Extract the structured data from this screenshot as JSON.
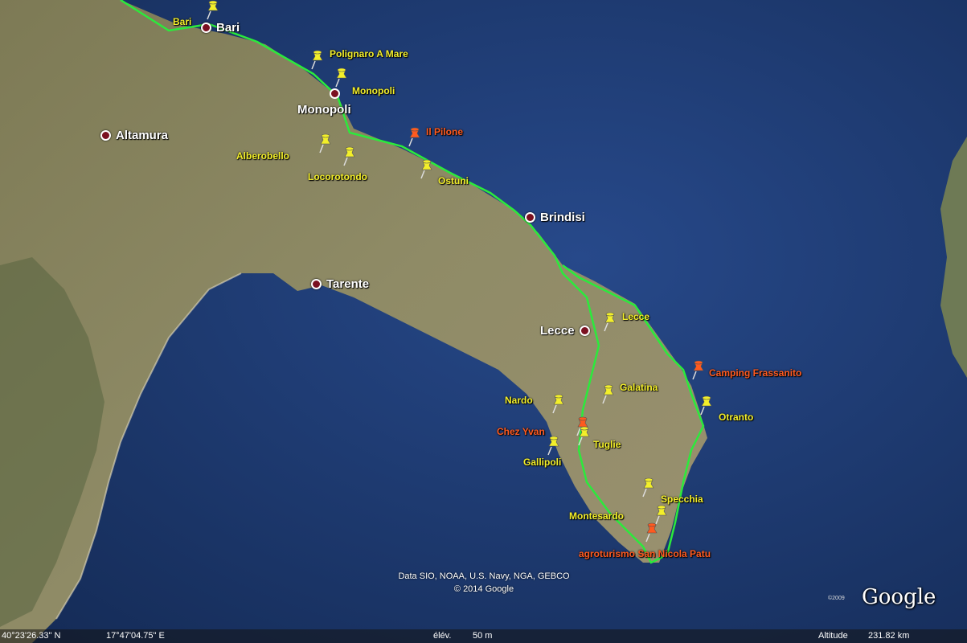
{
  "cities": [
    {
      "name": "Bari"
    },
    {
      "name": "Monopoli"
    },
    {
      "name": "Altamura"
    },
    {
      "name": "Brindisi"
    },
    {
      "name": "Tarente"
    },
    {
      "name": "Lecce"
    }
  ],
  "pins": [
    {
      "label": "Bari",
      "color": "#f3ef2a"
    },
    {
      "label": "Polignaro A Mare",
      "color": "#f3ef2a"
    },
    {
      "label": "Monopoli",
      "color": "#f3ef2a"
    },
    {
      "label": "Il Pilone",
      "color": "#ff5a1f"
    },
    {
      "label": "Alberobello",
      "color": "#f3ef2a"
    },
    {
      "label": "Locorotondo",
      "color": "#f3ef2a"
    },
    {
      "label": "Ostuni",
      "color": "#f3ef2a"
    },
    {
      "label": "Lecce",
      "color": "#f3ef2a"
    },
    {
      "label": "Camping Frassanito",
      "color": "#ff5a1f"
    },
    {
      "label": "Galatina",
      "color": "#f3ef2a"
    },
    {
      "label": "Otranto",
      "color": "#f3ef2a"
    },
    {
      "label": "Nardo",
      "color": "#f3ef2a"
    },
    {
      "label": "Chez Yvan",
      "color": "#ff5a1f"
    },
    {
      "label": "Tuglie",
      "color": "#f3ef2a"
    },
    {
      "label": "Gallipoli",
      "color": "#f3ef2a"
    },
    {
      "label": "Specchia",
      "color": "#f3ef2a"
    },
    {
      "label": "Montesardo",
      "color": "#f3ef2a"
    },
    {
      "label": "agroturismo San Nicola Patu",
      "color": "#ff5a1f"
    }
  ],
  "credits": {
    "line1": "Data SIO, NOAA, U.S. Navy, NGA, GEBCO",
    "line2": "© 2014 Google"
  },
  "logo": {
    "text": "Google",
    "small": "©2009"
  },
  "status": {
    "lat": "40°23'26.33\" N",
    "lon": "17°47'04.75\" E",
    "elev_label": "élév.",
    "elev_value": "50 m",
    "alt_label": "Altitude",
    "alt_value": "231.82 km"
  },
  "colors": {
    "sea": "#1d3a6e",
    "land": "#8a8560",
    "route": "#2bea3c",
    "pin_yellow": "#f3ef2a",
    "pin_red": "#ff5a1f"
  }
}
